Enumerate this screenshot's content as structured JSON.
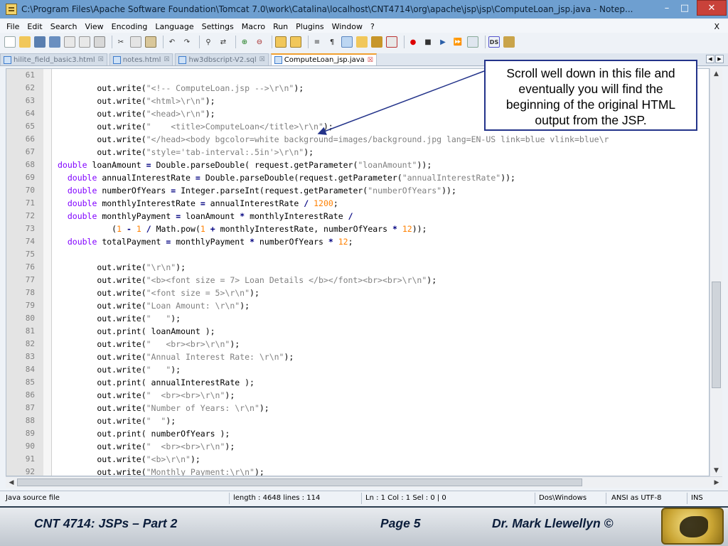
{
  "window": {
    "title": "C:\\Program Files\\Apache Software Foundation\\Tomcat 7.0\\work\\Catalina\\localhost\\CNT4714\\org\\apache\\jsp\\jsp\\ComputeLoan_jsp.java - Notep...",
    "min": "–",
    "max": "□",
    "close": "✕"
  },
  "menu": {
    "items": [
      "File",
      "Edit",
      "Search",
      "View",
      "Encoding",
      "Language",
      "Settings",
      "Macro",
      "Run",
      "Plugins",
      "Window",
      "?"
    ],
    "close": "X"
  },
  "tabs": [
    {
      "label": "hilite_field_basic3.html",
      "active": false
    },
    {
      "label": "notes.html",
      "active": false
    },
    {
      "label": "hw3dbscript-V2.sql",
      "active": false
    },
    {
      "label": "ComputeLoan_jsp.java",
      "active": true
    }
  ],
  "code_lines": [
    {
      "n": "61",
      "html": ""
    },
    {
      "n": "62",
      "html": "        out.write(<span class=\"str\">\"&lt;!-- ComputeLoan.jsp --&gt;\\r\\n\"</span>);"
    },
    {
      "n": "63",
      "html": "        out.write(<span class=\"str\">\"&lt;html&gt;\\r\\n\"</span>);"
    },
    {
      "n": "64",
      "html": "        out.write(<span class=\"str\">\"&lt;head&gt;\\r\\n\"</span>);"
    },
    {
      "n": "65",
      "html": "        out.write(<span class=\"str\">\"    &lt;title&gt;ComputeLoan&lt;/title&gt;\\r\\n\"</span>);"
    },
    {
      "n": "66",
      "html": "        out.write(<span class=\"str\">\"&lt;/head&gt;&lt;body bgcolor=white background=images/background.jpg lang=EN-US link=blue vlink=blue\\r</span>"
    },
    {
      "n": "67",
      "html": "        out.write(<span class=\"str\">\"style='tab-interval:.5in'&gt;\\r\\n\"</span>);"
    },
    {
      "n": "68",
      "html": "<span class=\"kw\">double</span> loanAmount <span class=\"op\">=</span> Double.parseDouble( request.getParameter(<span class=\"str\">\"loanAmount\"</span>));"
    },
    {
      "n": "69",
      "html": "  <span class=\"kw\">double</span> annualInterestRate <span class=\"op\">=</span> Double.parseDouble(request.getParameter(<span class=\"str\">\"annualInterestRate\"</span>));"
    },
    {
      "n": "70",
      "html": "  <span class=\"kw\">double</span> numberOfYears <span class=\"op\">=</span> Integer.parseInt(request.getParameter(<span class=\"str\">\"numberOfYears\"</span>));"
    },
    {
      "n": "71",
      "html": "  <span class=\"kw\">double</span> monthlyInterestRate <span class=\"op\">=</span> annualInterestRate <span class=\"op\">/</span> <span class=\"num\">1200</span>;"
    },
    {
      "n": "72",
      "html": "  <span class=\"kw\">double</span> monthlyPayment <span class=\"op\">=</span> loanAmount <span class=\"op\">*</span> monthlyInterestRate <span class=\"op\">/</span>"
    },
    {
      "n": "73",
      "html": "           (<span class=\"num\">1</span> <span class=\"op\">-</span> <span class=\"num\">1</span> <span class=\"op\">/</span> Math.pow(<span class=\"num\">1</span> <span class=\"op\">+</span> monthlyInterestRate, numberOfYears <span class=\"op\">*</span> <span class=\"num\">12</span>));"
    },
    {
      "n": "74",
      "html": "  <span class=\"kw\">double</span> totalPayment <span class=\"op\">=</span> monthlyPayment <span class=\"op\">*</span> numberOfYears <span class=\"op\">*</span> <span class=\"num\">12</span>;"
    },
    {
      "n": "75",
      "html": ""
    },
    {
      "n": "76",
      "html": "        out.write(<span class=\"str\">\"\\r\\n\"</span>);"
    },
    {
      "n": "77",
      "html": "        out.write(<span class=\"str\">\"&lt;b&gt;&lt;font size = 7&gt; Loan Details &lt;/b&gt;&lt;/font&gt;&lt;br&gt;&lt;br&gt;\\r\\n\"</span>);"
    },
    {
      "n": "78",
      "html": "        out.write(<span class=\"str\">\"&lt;font size = 5&gt;\\r\\n\"</span>);"
    },
    {
      "n": "79",
      "html": "        out.write(<span class=\"str\">\"Loan Amount: \\r\\n\"</span>);"
    },
    {
      "n": "80",
      "html": "        out.write(<span class=\"str\">\"   \"</span>);"
    },
    {
      "n": "81",
      "html": "        out.print( loanAmount );"
    },
    {
      "n": "82",
      "html": "        out.write(<span class=\"str\">\"   &lt;br&gt;&lt;br&gt;\\r\\n\"</span>);"
    },
    {
      "n": "83",
      "html": "        out.write(<span class=\"str\">\"Annual Interest Rate: \\r\\n\"</span>);"
    },
    {
      "n": "84",
      "html": "        out.write(<span class=\"str\">\"   \"</span>);"
    },
    {
      "n": "85",
      "html": "        out.print( annualInterestRate );"
    },
    {
      "n": "86",
      "html": "        out.write(<span class=\"str\">\"  &lt;br&gt;&lt;br&gt;\\r\\n\"</span>);"
    },
    {
      "n": "87",
      "html": "        out.write(<span class=\"str\">\"Number of Years: \\r\\n\"</span>);"
    },
    {
      "n": "88",
      "html": "        out.write(<span class=\"str\">\"  \"</span>);"
    },
    {
      "n": "89",
      "html": "        out.print( numberOfYears );"
    },
    {
      "n": "90",
      "html": "        out.write(<span class=\"str\">\"  &lt;br&gt;&lt;br&gt;\\r\\n\"</span>);"
    },
    {
      "n": "91",
      "html": "        out.write(<span class=\"str\">\"&lt;b&gt;\\r\\n\"</span>);"
    },
    {
      "n": "92",
      "html": "        out.write(<span class=\"str\">\"Monthly Payment:\\r\\n\"</span>);"
    }
  ],
  "status": {
    "type": "Java source file",
    "length": "length : 4648    lines : 114",
    "position": "Ln : 1    Col : 1    Sel : 0 | 0",
    "eol": "Dos\\Windows",
    "encoding": "ANSI as UTF-8",
    "mode": "INS"
  },
  "callout": {
    "lines": [
      "Scroll well down in this file and",
      "eventually you will find the",
      "beginning of the original HTML",
      "output from the JSP."
    ]
  },
  "footer": {
    "left": "CNT 4714: JSPs – Part 2",
    "center": "Page 5",
    "right": "Dr. Mark Llewellyn ©"
  },
  "colors": {
    "titlebar": "#6e9fd0",
    "keyword": "#8000ff",
    "string": "#808080",
    "number": "#ff8000",
    "callout_border": "#23338a"
  }
}
